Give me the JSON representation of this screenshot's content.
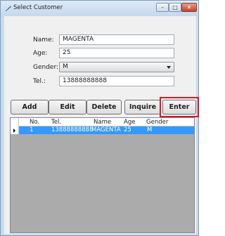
{
  "window": {
    "title": "Select Customer",
    "minimize_glyph": "–",
    "maximize_glyph": "□",
    "close_glyph": "✕"
  },
  "form": {
    "name_label": "Name:",
    "name_value": "MAGENTA",
    "age_label": "Age:",
    "age_value": "25",
    "gender_label": "Gender:",
    "gender_value": "M",
    "tel_label": "Tel.:",
    "tel_value": "13888888888"
  },
  "buttons": {
    "add": "Add",
    "edit": "Edit",
    "delete": "Delete",
    "inquire": "Inquire",
    "enter": "Enter"
  },
  "grid": {
    "columns": [
      "No.",
      "Tel.",
      "Name",
      "Age",
      "Gender"
    ],
    "rows": [
      [
        "1",
        "13888888888",
        "MAGENTA",
        "25",
        "M"
      ]
    ],
    "selected_row_color": "#3399ff"
  },
  "colors": {
    "highlight_box": "#d6182a"
  },
  "icons": {
    "title_icon": "app-feather-icon",
    "row_indicator": "row-pointer-icon",
    "dropdown": "chevron-down-icon"
  }
}
